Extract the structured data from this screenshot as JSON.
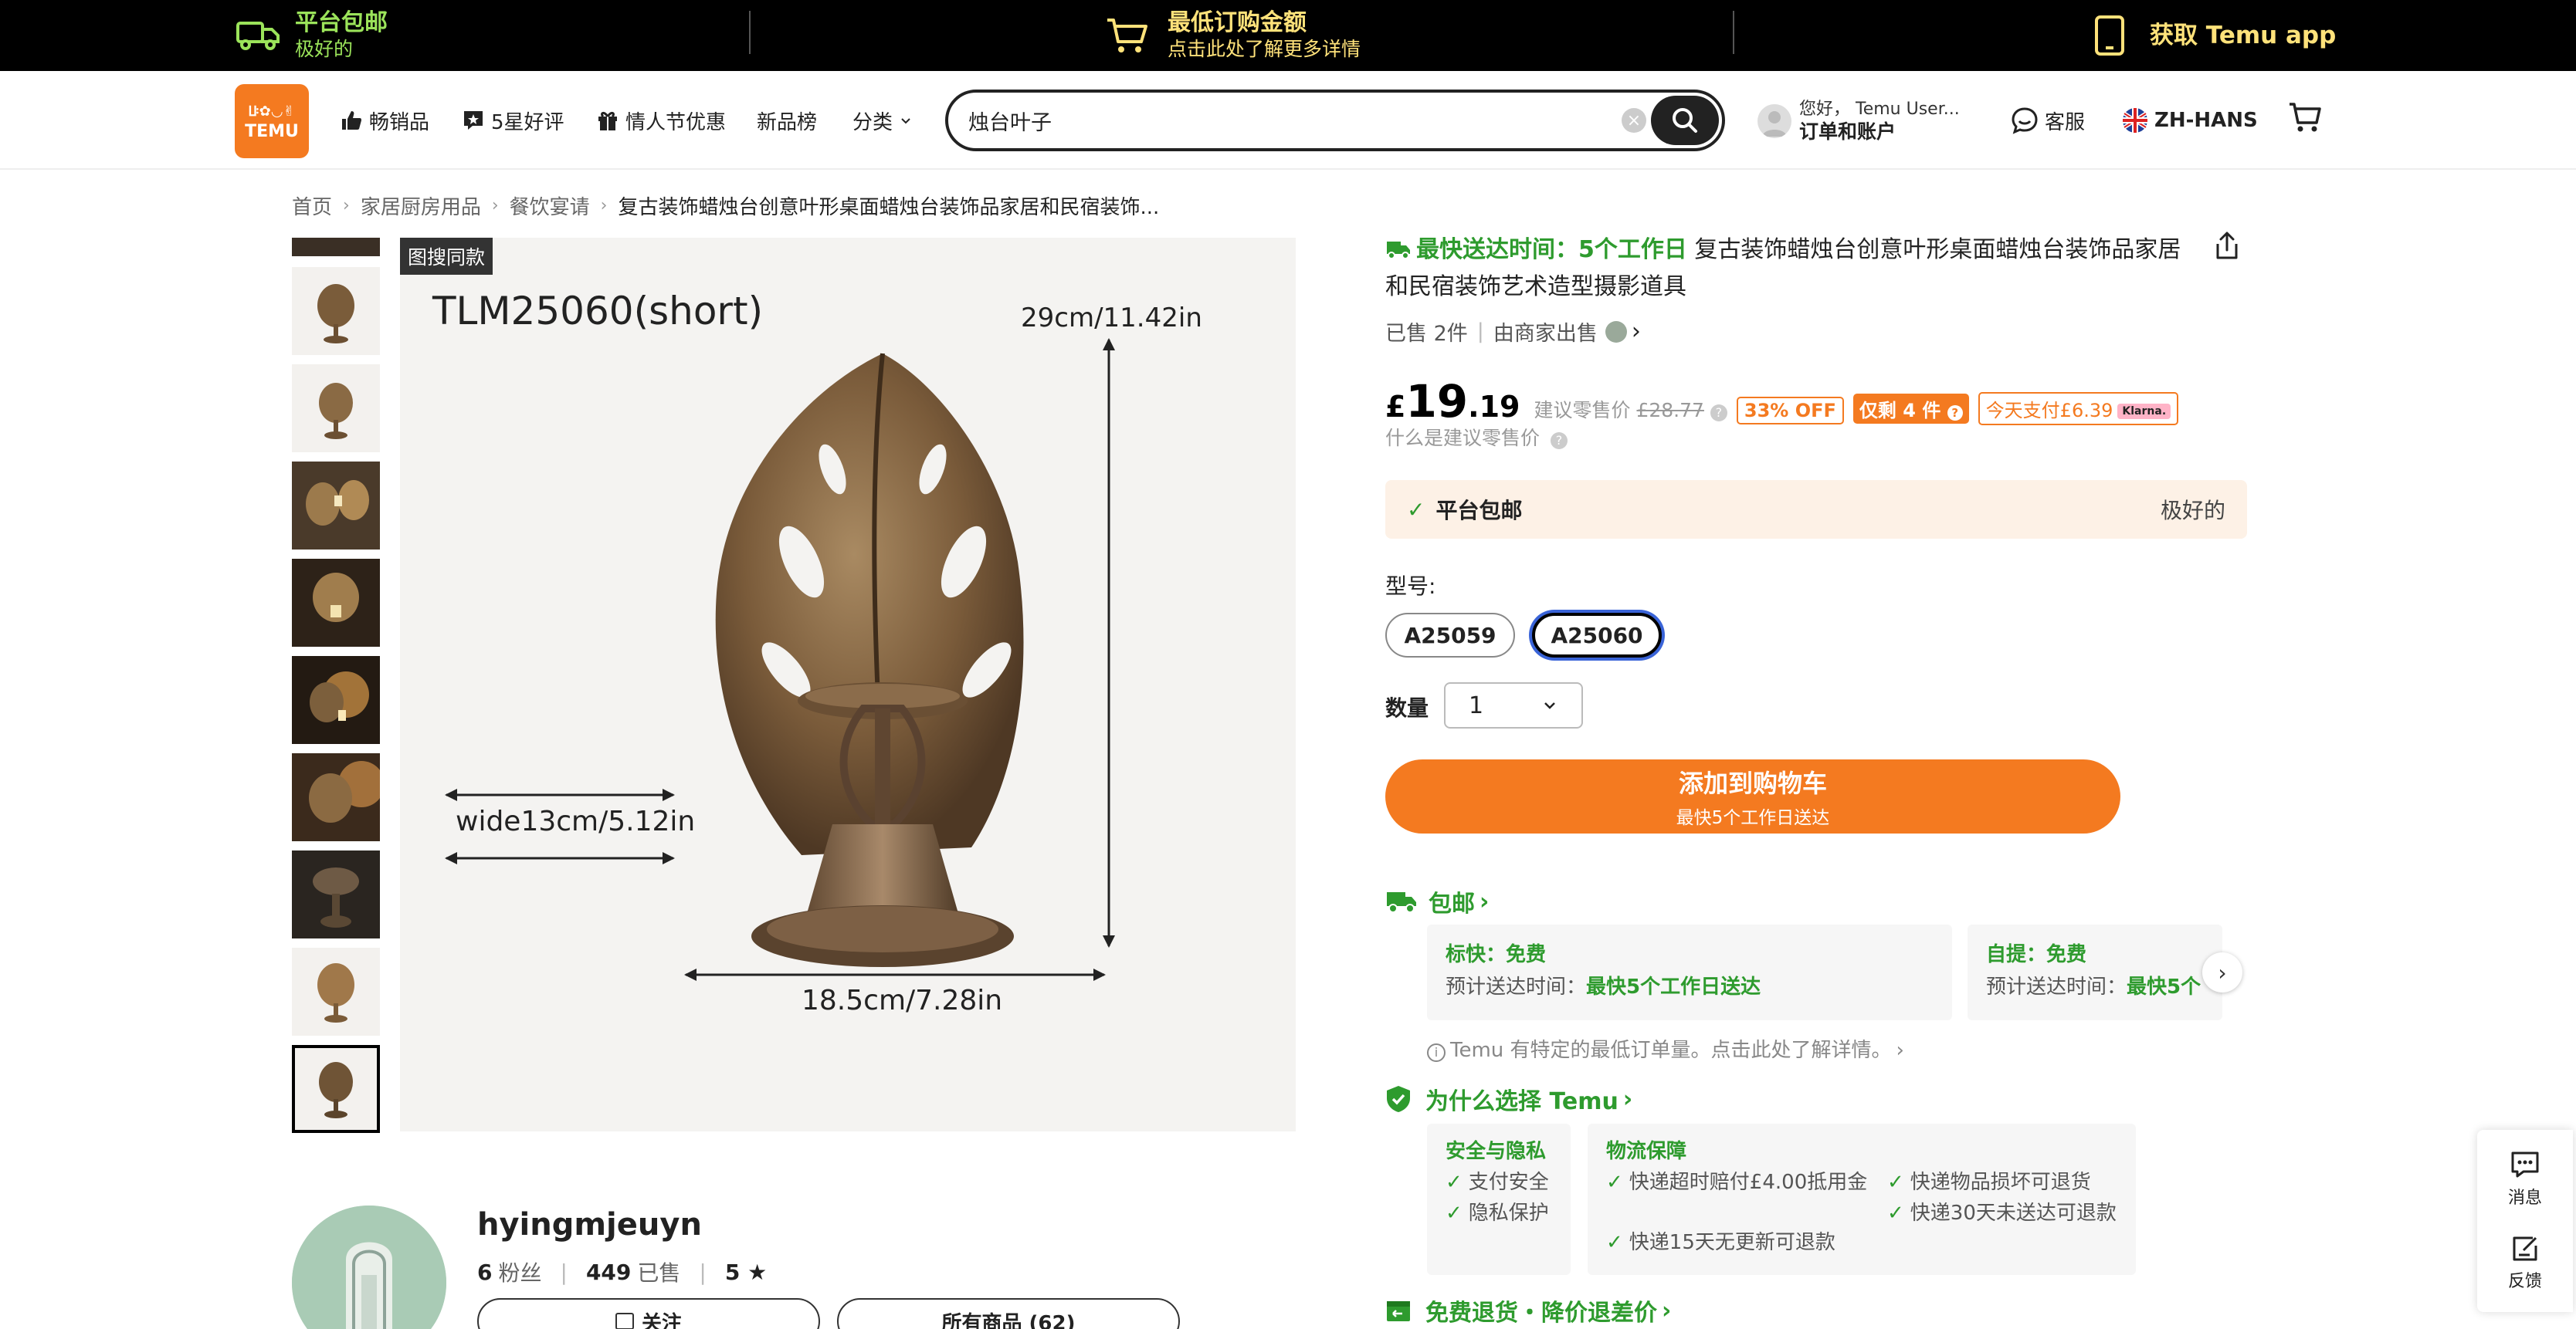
{
  "banner": {
    "free_ship_l1": "平台包邮",
    "free_ship_l2": "极好的",
    "min_order_l1": "最低订购金额",
    "min_order_l2": "点击此处了解更多详情",
    "get_app": "获取 Temu app"
  },
  "header": {
    "logo_top": "ꚶ✿◡✌",
    "logo_bottom": "TEMU",
    "nav": {
      "best_sellers": "畅销品",
      "five_star": "5星好评",
      "valentine": "情人节优惠",
      "new_arrivals": "新品榜",
      "categories": "分类"
    },
    "search_value": "烛台叶子",
    "account_greeting": "您好， Temu User...",
    "account_label": "订单和账户",
    "support": "客服",
    "language": "ZH-HANS"
  },
  "breadcrumb": {
    "items": [
      "首页",
      "家居厨房用品",
      "餐饮宴请",
      "复古装饰蜡烛台创意叶形桌面蜡烛台装饰品家居和民宿装饰..."
    ]
  },
  "gallery": {
    "tag": "图搜同款",
    "model_label": "TLM25060(short)",
    "height_label": "29cm/11.42in",
    "width_label": "wide13cm/5.12in",
    "base_label": "18.5cm/7.28in"
  },
  "product": {
    "fast_delivery": "最快送达时间：5个工作日",
    "title": "复古装饰蜡烛台创意叶形桌面蜡烛台装饰品家居和民宿装饰艺术造型摄影道具",
    "sold": "已售 2件",
    "seller": "由商家出售",
    "price_currency": "£",
    "price_int": "19",
    "price_dec": ".19",
    "rrp_label": "建议零售价",
    "rrp_value": "£28.77",
    "discount": "33% OFF",
    "stock_left": "仅剩 4 件",
    "pay_today": "今天支付£6.39",
    "klarna": "Klarna.",
    "what_rrp": "什么是建议零售价",
    "free_ship_name": "平台包邮",
    "free_ship_value": "极好的",
    "model_label": "型号:",
    "models": [
      "A25059",
      "A25060"
    ],
    "qty_label": "数量",
    "qty_value": "1",
    "cart_button": "添加到购物车",
    "cart_sub": "最快5个工作日送达"
  },
  "shipping": {
    "head": "包邮",
    "standard_title": "标快：免费",
    "standard_label": "预计送达时间：",
    "standard_value": "最快5个工作日送达",
    "pickup_title": "自提：免费",
    "pickup_label": "预计送达时间：",
    "pickup_value": "最快5个",
    "min_order_note": "Temu 有特定的最低订单量。点击此处了解详情。"
  },
  "why": {
    "head": "为什么选择 Temu",
    "security_title": "安全与隐私",
    "security_items": [
      "支付安全",
      "隐私保护"
    ],
    "logistics_title": "物流保障",
    "logistics_items": [
      "快递超时赔付£4.00抵用金",
      "快递物品损坏可退货",
      "快递15天无更新可退款",
      "快递30天未送达可退款"
    ],
    "refund": "免费退货・降价退差价"
  },
  "store": {
    "name": "hyingmjeuyn",
    "followers_num": "6",
    "followers_label": "粉丝",
    "sold_num": "449",
    "sold_label": "已售",
    "rating": "5 ★",
    "follow": "关注",
    "all_products": "所有商品 (62)"
  },
  "side": {
    "messages": "消息",
    "feedback": "反馈"
  },
  "colors": {
    "brand_orange": "#f47a20",
    "green": "#2e9b2e",
    "banner_bg": "#000000"
  }
}
